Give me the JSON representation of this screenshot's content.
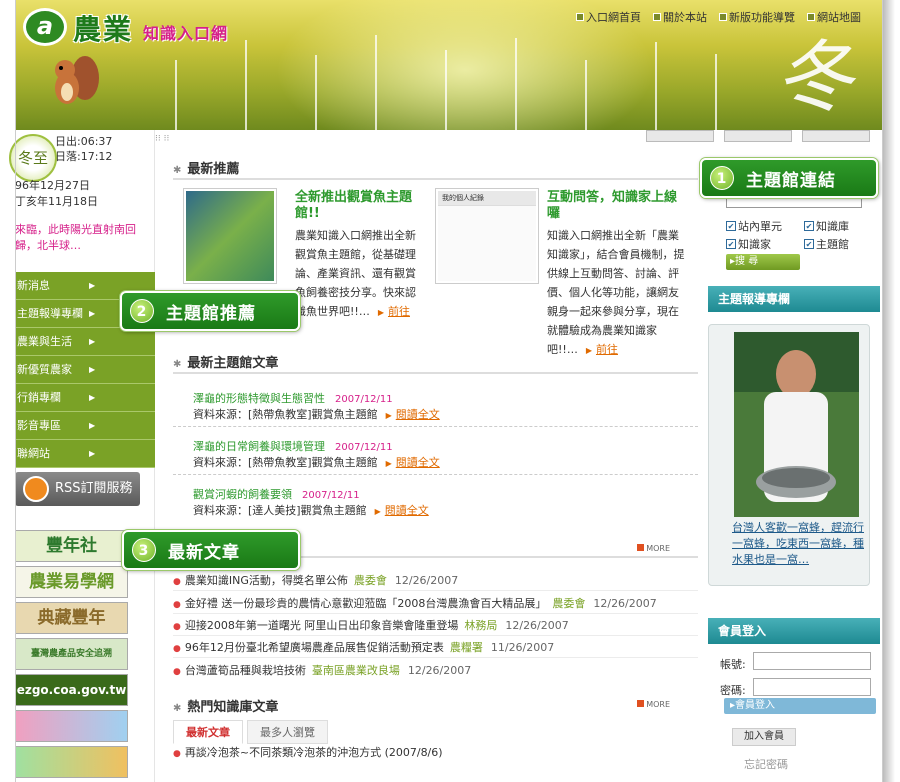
{
  "header": {
    "logo_mark": "a",
    "logo_main": "農業",
    "logo_sub": "知識入口網",
    "season_glyph": "冬",
    "nav": [
      "入口網首頁",
      "關於本站",
      "新版功能導覽",
      "網站地圖"
    ]
  },
  "sidebar": {
    "season_badge": "冬至",
    "sunrise": "日出:06:37",
    "sunset": "日落:17:12",
    "date_line1": "96年12月27日",
    "date_line2": "丁亥年11月18日",
    "notice": "來臨，此時陽光直射南回歸，北半球…",
    "menu": [
      "新消息",
      "主題報導專欄",
      "農業與生活",
      "新優質農家",
      "行銷專欄",
      "影音專區",
      "聯網站"
    ],
    "rss_label": "RSS訂閱服務",
    "banners": [
      "豐年社",
      "農業易學網",
      "典藏豐年",
      "臺灣農產品安全追溯",
      "ezgo.coa.gov.tw",
      "",
      ""
    ]
  },
  "main": {
    "recommend_title": "最新推薦",
    "feature1": {
      "title": "全新推出觀賞魚主題館!!",
      "body": "農業知識入口網推出全新觀賞魚主題館，從基礎理論、產業資訊、還有觀賞魚飼養密技分享。快來認識魚世界吧!!…",
      "go": "前往"
    },
    "feature2": {
      "title": "互動問答，知識家上線囉",
      "body": "知識入口網推出全新「農業知識家」，結合會員機制，提供線上互動問答、討論、評價、個人化等功能，讓網友親身一起來參與分享，現在就體驗成為農業知識家吧!!…",
      "go": "前往",
      "thumb_header": "我的個人紀錄"
    },
    "articles_title": "最新主題館文章",
    "articles": [
      {
        "title": "澤龜的形態特徵與生態習性",
        "date": "2007/12/11",
        "source": "資料來源：[熱帶魚教室]觀賞魚主題館",
        "read": "閱讀全文"
      },
      {
        "title": "澤龜的日常飼養與環境管理",
        "date": "2007/12/11",
        "source": "資料來源：[熱帶魚教室]觀賞魚主題館",
        "read": "閱讀全文"
      },
      {
        "title": "觀賞河蝦的飼養要領",
        "date": "2007/12/11",
        "source": "資料來源：[達人美技]觀賞魚主題館",
        "read": "閱讀全文"
      }
    ],
    "more_label": "MORE",
    "news": [
      {
        "title": "農業知識ING活動，得獎名單公佈",
        "agency": "農委會",
        "date": "12/26/2007"
      },
      {
        "title": "金好禮 送一份最珍貴的農情心意歡迎蒞臨「2008台灣農漁會百大精品展」",
        "agency": "農委會",
        "date": "12/26/2007"
      },
      {
        "title": "迎接2008年第一道曙光 阿里山日出印象音樂會隆重登場",
        "agency": "林務局",
        "date": "12/26/2007"
      },
      {
        "title": "96年12月份臺北希望廣場農產品展售促銷活動預定表",
        "agency": "農糧署",
        "date": "11/26/2007"
      },
      {
        "title": "台灣蘆筍品種與栽培技術",
        "agency": "臺南區農業改良場",
        "date": "12/26/2007"
      }
    ],
    "popular_title": "熱門知識庫文章",
    "tabs": [
      "最新文章",
      "最多人瀏覽"
    ],
    "popular": [
      {
        "title": "再談冷泡茶~不同茶類冷泡茶的沖泡方式 (2007/8/6)"
      }
    ]
  },
  "right": {
    "checkboxes": [
      "站內單元",
      "知識庫",
      "知識家",
      "主題館"
    ],
    "search_label": "搜 尋",
    "report_head": "主題報導專欄",
    "report_caption": "台灣人客歡一窩蜂，趕流行一窩蜂，吃東西一窩蜂，種水果也是一窩…",
    "login_head": "會員登入",
    "account_label": "帳號:",
    "password_label": "密碼:",
    "login_btn": "會員登入",
    "join_btn": "加入會員",
    "forgot": "忘記密碼"
  },
  "callouts": [
    {
      "num": "1",
      "label": "主題館連結"
    },
    {
      "num": "2",
      "label": "主題館推薦"
    },
    {
      "num": "3",
      "label": "最新文章"
    }
  ],
  "colors": {
    "brand_green": "#7aa226",
    "callout_green": "#1a7a16",
    "teal": "#1e8a92",
    "title_green": "#2e9a2e",
    "accent_pink": "#d6208a",
    "link_orange": "#e06a00"
  }
}
